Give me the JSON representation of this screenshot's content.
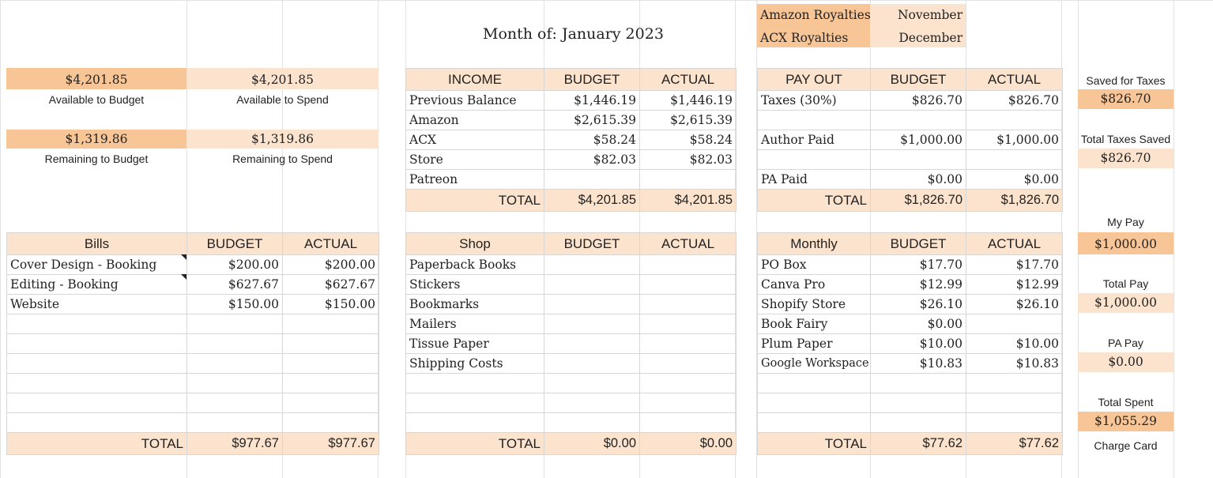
{
  "royalty_months": [
    {
      "label": "Amazon Royalties",
      "month": "November"
    },
    {
      "label": "ACX Royalties",
      "month": "December"
    }
  ],
  "title": "Month of: January 2023",
  "summary": {
    "available_to_budget_value": "$4,201.85",
    "available_to_budget_label": "Available to Budget",
    "available_to_spend_value": "$4,201.85",
    "available_to_spend_label": "Available to Spend",
    "remaining_to_budget_value": "$1,319.86",
    "remaining_to_budget_label": "Remaining to Budget",
    "remaining_to_spend_value": "$1,319.86",
    "remaining_to_spend_label": "Remaining to Spend"
  },
  "income": {
    "headers": [
      "INCOME",
      "BUDGET",
      "ACTUAL"
    ],
    "rows": [
      [
        "Previous Balance",
        "$1,446.19",
        "$1,446.19"
      ],
      [
        "Amazon",
        "$2,615.39",
        "$2,615.39"
      ],
      [
        "ACX",
        "$58.24",
        "$58.24"
      ],
      [
        "Store",
        "$82.03",
        "$82.03"
      ],
      [
        "Patreon",
        "",
        ""
      ]
    ],
    "total": [
      "TOTAL",
      "$4,201.85",
      "$4,201.85"
    ]
  },
  "payout": {
    "headers": [
      "PAY OUT",
      "BUDGET",
      "ACTUAL"
    ],
    "rows": [
      [
        "Taxes (30%)",
        "$826.70",
        "$826.70"
      ],
      [
        "",
        "",
        ""
      ],
      [
        "Author Paid",
        "$1,000.00",
        "$1,000.00"
      ],
      [
        "",
        "",
        ""
      ],
      [
        "PA Paid",
        "$0.00",
        "$0.00"
      ]
    ],
    "total": [
      "TOTAL",
      "$1,826.70",
      "$1,826.70"
    ]
  },
  "bills": {
    "headers": [
      "Bills",
      "BUDGET",
      "ACTUAL"
    ],
    "rows": [
      [
        "Cover Design - Booking",
        "$200.00",
        "$200.00"
      ],
      [
        "Editing - Booking",
        "$627.67",
        "$627.67"
      ],
      [
        "Website",
        "$150.00",
        "$150.00"
      ],
      [
        "",
        "",
        ""
      ],
      [
        "",
        "",
        ""
      ],
      [
        "",
        "",
        ""
      ],
      [
        "",
        "",
        ""
      ],
      [
        "",
        "",
        ""
      ],
      [
        "",
        "",
        ""
      ]
    ],
    "total": [
      "TOTAL",
      "$977.67",
      "$977.67"
    ]
  },
  "shop": {
    "headers": [
      "Shop",
      "BUDGET",
      "ACTUAL"
    ],
    "rows": [
      [
        "Paperback Books",
        "",
        ""
      ],
      [
        "Stickers",
        "",
        ""
      ],
      [
        "Bookmarks",
        "",
        ""
      ],
      [
        "Mailers",
        "",
        ""
      ],
      [
        "Tissue Paper",
        "",
        ""
      ],
      [
        "Shipping Costs",
        "",
        ""
      ],
      [
        "",
        "",
        ""
      ],
      [
        "",
        "",
        ""
      ],
      [
        "",
        "",
        ""
      ]
    ],
    "total": [
      "TOTAL",
      "$0.00",
      "$0.00"
    ]
  },
  "monthly": {
    "headers": [
      "Monthly",
      "BUDGET",
      "ACTUAL"
    ],
    "rows": [
      [
        "PO Box",
        "$17.70",
        "$17.70"
      ],
      [
        "Canva Pro",
        "$12.99",
        "$12.99"
      ],
      [
        "Shopify Store",
        "$26.10",
        "$26.10"
      ],
      [
        "Book Fairy",
        "$0.00",
        ""
      ],
      [
        "Plum Paper",
        "$10.00",
        "$10.00"
      ],
      [
        "Google Workspace",
        "$10.83",
        "$10.83"
      ],
      [
        "",
        "",
        ""
      ],
      [
        "",
        "",
        ""
      ],
      [
        "",
        "",
        ""
      ]
    ],
    "total": [
      "TOTAL",
      "$77.62",
      "$77.62"
    ]
  },
  "side": {
    "saved_for_taxes_label": "Saved for Taxes",
    "saved_for_taxes_value": "$826.70",
    "total_taxes_saved_label": "Total Taxes Saved",
    "total_taxes_saved_value": "$826.70",
    "my_pay_label": "My Pay",
    "my_pay_value": "$1,000.00",
    "total_pay_label": "Total Pay",
    "total_pay_value": "$1,000.00",
    "pa_pay_label": "PA Pay",
    "pa_pay_value": "$0.00",
    "total_spent_label": "Total Spent",
    "total_spent_value": "$1,055.29",
    "charge_card_label": "Charge Card"
  },
  "colors": {
    "dark": "#f8c597",
    "light": "#fce3cd",
    "grid": "#e2e2e2"
  }
}
